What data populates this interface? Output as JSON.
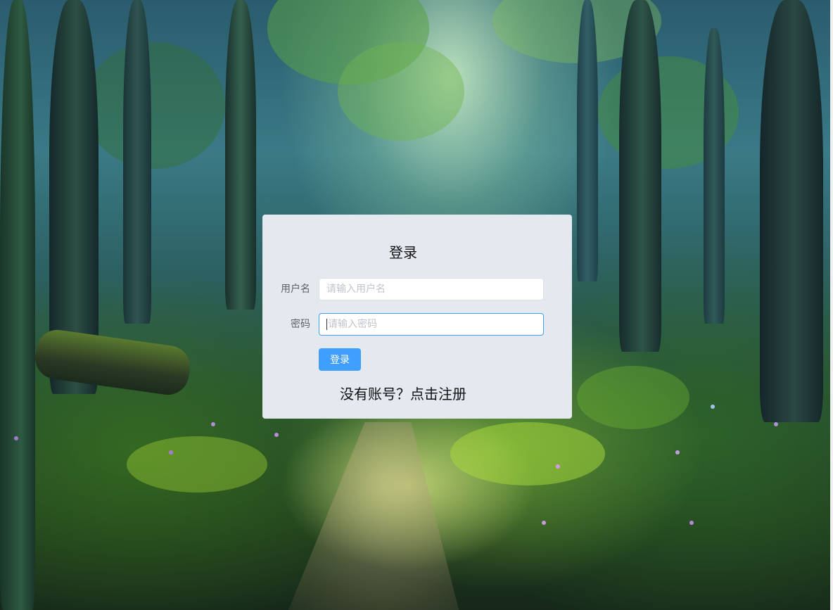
{
  "login_form": {
    "title": "登录",
    "username_label": "用户名",
    "username_placeholder": "请输入用户名",
    "password_label": "密码",
    "password_placeholder": "请输入密码",
    "submit_label": "登录",
    "register_link": "没有账号？点击注册"
  },
  "colors": {
    "primary": "#409eff",
    "card_bg": "#e4e8ef"
  }
}
